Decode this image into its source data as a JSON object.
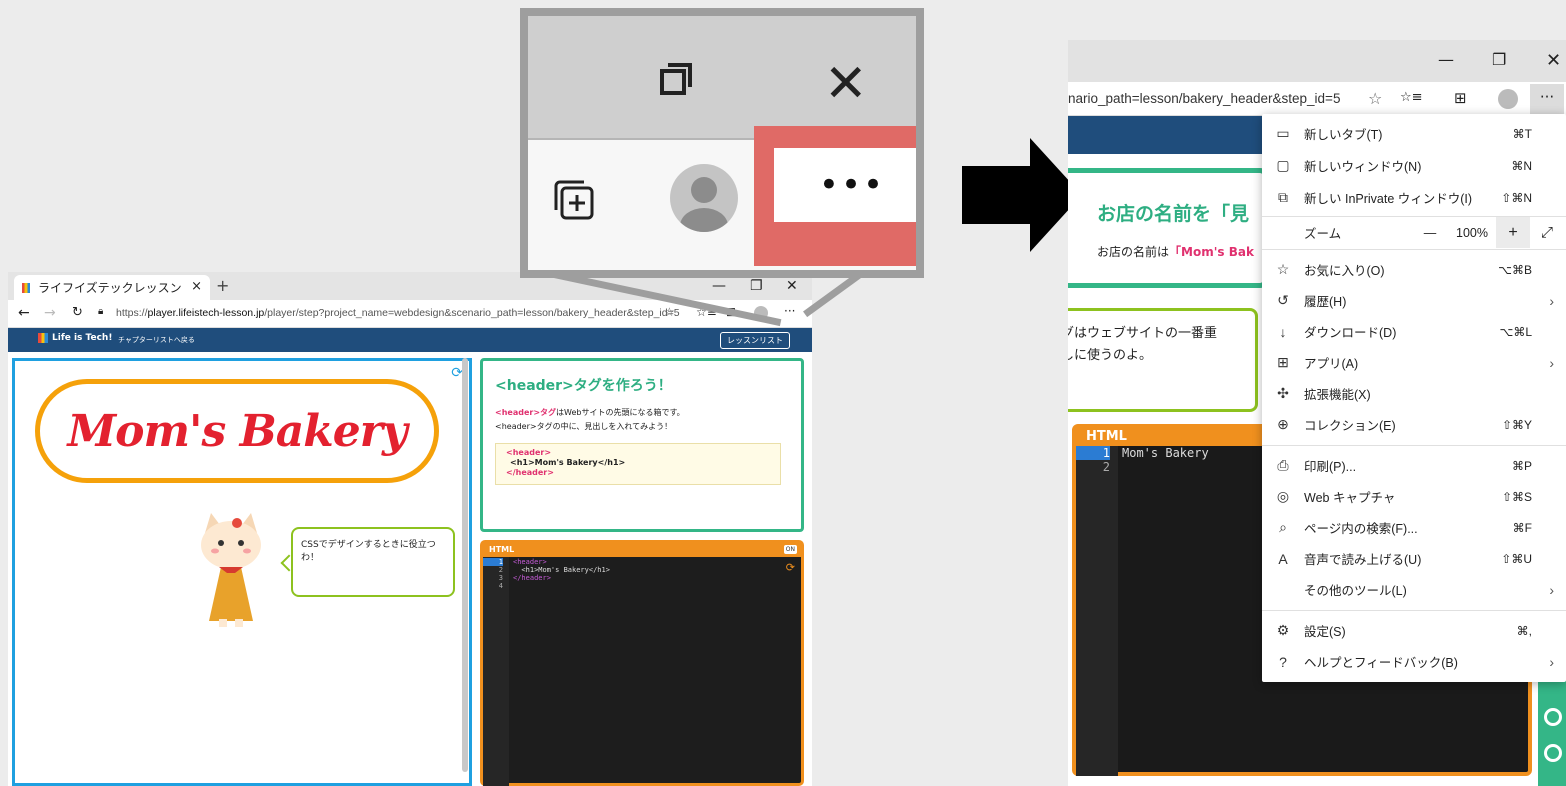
{
  "left_browser": {
    "tab_title": "ライフイズテックレッスン",
    "tab_close": "×",
    "new_tab": "+",
    "win_minimize": "—",
    "win_restore": "❐",
    "win_close": "✕",
    "url_prefix": "https://",
    "url_domain": "player.lifeistech-lesson.jp",
    "url_path": "/player/step?project_name=webdesign&scenario_path=lesson/bakery_header&step_id=5",
    "more": "···",
    "logo_text": "Life is Tech!",
    "back_link": "チャプターリストへ戻る",
    "lesson_list_button": "レッスンリスト",
    "preview_title": "Mom's Bakery",
    "cat_bubble": "CSSでデザインするときに役立つわ！",
    "lesson_heading": "<header>タグを作ろう！",
    "lesson_line1_tag": "<header>タグ",
    "lesson_line1_rest": "はWebサイトの先頭になる箱です。",
    "lesson_line2": "<header>タグの中に、見出しを入れてみよう！",
    "example_code": [
      "<header>",
      "<h1>Mom's Bakery</h1>",
      "</header>"
    ],
    "editor_title": "HTML",
    "editor_toggle": "ON",
    "editor_line_numbers": [
      "1",
      "2",
      "3",
      "4"
    ],
    "editor_lines": [
      "<header>",
      "  <h1>Mom's Bakery</h1>",
      "</header>",
      ""
    ]
  },
  "right_browser": {
    "win_minimize": "—",
    "win_restore": "❐",
    "win_close": "✕",
    "url_visible": "nario_path=lesson/bakery_header&step_id=5",
    "more": "···",
    "lesson_heading": "お店の名前を「見",
    "lesson_line_prefix": "お店の名前は",
    "lesson_line_highlight": "「Mom's Bak",
    "bubble_line1": "グはウェブサイトの一番重",
    "bubble_line2": "しに使うのよ。",
    "editor_title": "HTML",
    "editor_line_numbers": [
      "1",
      "2"
    ],
    "editor_lines": [
      "Mom's Bakery",
      ""
    ]
  },
  "menu": {
    "items": [
      {
        "label": "新しいタブ(T)",
        "shortcut": "⌘T",
        "icon": "new-tab-icon"
      },
      {
        "label": "新しいウィンドウ(N)",
        "shortcut": "⌘N",
        "icon": "new-window-icon"
      },
      {
        "label": "新しい InPrivate ウィンドウ(I)",
        "shortcut": "⇧⌘N",
        "icon": "inprivate-icon"
      },
      {
        "label": "ズーム",
        "shortcut": "",
        "icon": ""
      },
      {
        "label": "お気に入り(O)",
        "shortcut": "⌥⌘B",
        "icon": "favorites-icon"
      },
      {
        "label": "履歴(H)",
        "shortcut": "",
        "icon": "history-icon"
      },
      {
        "label": "ダウンロード(D)",
        "shortcut": "⌥⌘L",
        "icon": "download-icon"
      },
      {
        "label": "アプリ(A)",
        "shortcut": "",
        "icon": "apps-icon"
      },
      {
        "label": "拡張機能(X)",
        "shortcut": "",
        "icon": "extensions-icon"
      },
      {
        "label": "コレクション(E)",
        "shortcut": "⇧⌘Y",
        "icon": "collections-icon"
      },
      {
        "label": "印刷(P)...",
        "shortcut": "⌘P",
        "icon": "print-icon"
      },
      {
        "label": "Web キャプチャ",
        "shortcut": "⇧⌘S",
        "icon": "web-capture-icon"
      },
      {
        "label": "ページ内の検索(F)...",
        "shortcut": "⌘F",
        "icon": "find-icon"
      },
      {
        "label": "音声で読み上げる(U)",
        "shortcut": "⇧⌘U",
        "icon": "read-aloud-icon"
      },
      {
        "label": "その他のツール(L)",
        "shortcut": "",
        "icon": ""
      },
      {
        "label": "設定(S)",
        "shortcut": "⌘,",
        "icon": "settings-icon"
      },
      {
        "label": "ヘルプとフィードバック(B)",
        "shortcut": "",
        "icon": "help-icon"
      }
    ],
    "zoom_minus": "—",
    "zoom_value": "100%",
    "zoom_plus": "+",
    "zoom_fullscreen": "⤢",
    "submenu_arrow": "›"
  },
  "magnifier": {
    "more_dots": "•••",
    "close_glyph": "✕"
  },
  "colors": {
    "highlight_red": "#e06a66",
    "site_navy": "#1f4d7c",
    "lesson_green": "#34b687",
    "editor_orange": "#f0901e",
    "preview_blue": "#1fa0e0",
    "title_red": "#e3212f",
    "pill_orange": "#f5a10a"
  }
}
